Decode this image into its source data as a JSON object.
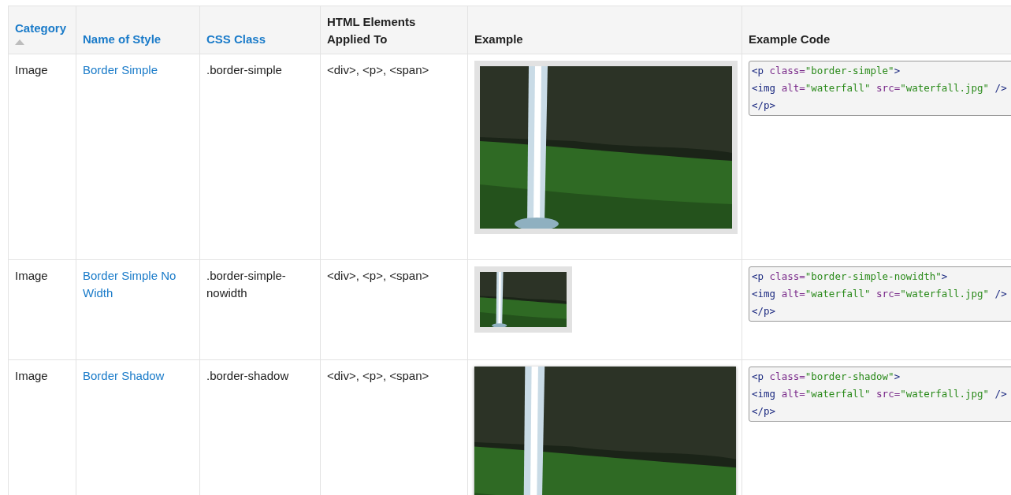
{
  "table": {
    "columns": [
      {
        "label": "Category",
        "sortable": true,
        "sorted": true
      },
      {
        "label": "Name of Style",
        "sortable": true,
        "sorted": false
      },
      {
        "label": "CSS Class",
        "sortable": true,
        "sorted": false
      },
      {
        "label": "HTML Elements Applied To",
        "sortable": false,
        "sorted": false
      },
      {
        "label": "Example",
        "sortable": false,
        "sorted": false
      },
      {
        "label": "Example Code",
        "sortable": false,
        "sorted": false
      }
    ],
    "rows": [
      {
        "category": "Image",
        "name": "Border Simple",
        "css_class": ".border-simple",
        "elements": "<div>, <p>, <span>",
        "example": {
          "kind": "framed",
          "thumbnail": false
        },
        "code": [
          "<p class=\"border-simple\">",
          "<img alt=\"waterfall\" src=\"waterfall.jpg\" />",
          "</p>"
        ]
      },
      {
        "category": "Image",
        "name": "Border Simple No Width",
        "css_class": ".border-simple-nowidth",
        "elements": "<div>, <p>, <span>",
        "example": {
          "kind": "framed",
          "thumbnail": true
        },
        "code": [
          "<p class=\"border-simple-nowidth\">",
          "<img alt=\"waterfall\" src=\"waterfall.jpg\" />",
          "</p>"
        ]
      },
      {
        "category": "Image",
        "name": "Border Shadow",
        "css_class": ".border-shadow",
        "elements": "<div>, <p>, <span>",
        "example": {
          "kind": "shadowed",
          "thumbnail": false
        },
        "code": [
          "<p class=\"border-shadow\">",
          "<img alt=\"waterfall\" src=\"waterfall.jpg\" />",
          "</p>"
        ]
      }
    ]
  }
}
